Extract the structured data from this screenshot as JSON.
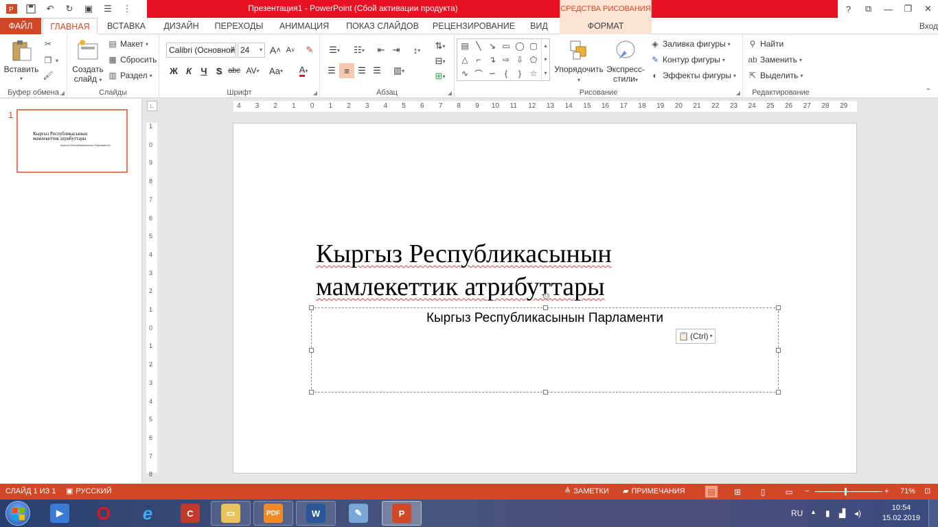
{
  "app": {
    "title": "Презентация1  -  PowerPoint (Сбой активации продукта)",
    "contextual_tab_group": "СРЕДСТВА РИСОВАНИЯ",
    "signin": "Вход",
    "accent": "#d24726"
  },
  "window_controls": {
    "help": "?",
    "restore_ribbon": "⧉",
    "minimize": "—",
    "maximize": "❐",
    "close": "✕"
  },
  "tabs": [
    "ФАЙЛ",
    "ГЛАВНАЯ",
    "ВСТАВКА",
    "ДИЗАЙН",
    "ПЕРЕХОДЫ",
    "АНИМАЦИЯ",
    "ПОКАЗ СЛАЙДОВ",
    "РЕЦЕНЗИРОВАНИЕ",
    "ВИД",
    "ФОРМАТ"
  ],
  "active_tab": "ГЛАВНАЯ",
  "ribbon": {
    "clipboard": {
      "label": "Буфер обмена",
      "paste": "Вставить"
    },
    "slides": {
      "label": "Слайды",
      "new_slide_1": "Создать",
      "new_slide_2": "слайд",
      "layout": "Макет",
      "reset": "Сбросить",
      "section": "Раздел"
    },
    "font": {
      "label": "Шрифт",
      "font_name": "Calibri (Основной",
      "font_size": "24",
      "bold": "Ж",
      "italic": "К",
      "underline": "Ч",
      "shadow": "S",
      "strike": "abc",
      "spacing": "AV",
      "case": "Aa",
      "color": "A",
      "grow": "A",
      "shrink": "A"
    },
    "paragraph": {
      "label": "Абзац"
    },
    "drawing": {
      "label": "Рисование",
      "arrange": "Упорядочить",
      "quick_styles_1": "Экспресс-",
      "quick_styles_2": "стили",
      "fill": "Заливка фигуры",
      "outline": "Контур фигуры",
      "effects": "Эффекты фигуры"
    },
    "editing": {
      "label": "Редактирование",
      "find": "Найти",
      "replace": "Заменить",
      "select": "Выделить"
    }
  },
  "thumbnails": [
    {
      "number": "1",
      "title": "Кыргыз Республикасынын мамлекеттик атрибуттары",
      "subtitle": "Кыргыз Республикасынын Парламенти"
    }
  ],
  "rulers": {
    "horizontal": [
      "4",
      "3",
      "2",
      "1",
      "0",
      "1",
      "2",
      "3",
      "4",
      "5",
      "6",
      "7",
      "8",
      "9",
      "10",
      "11",
      "12",
      "13",
      "14",
      "15",
      "16",
      "17",
      "18",
      "19",
      "20",
      "21",
      "22",
      "23",
      "24",
      "25",
      "26",
      "27",
      "28",
      "29"
    ],
    "vertical": [
      "11",
      "10",
      "9",
      "8",
      "7",
      "6",
      "5",
      "4",
      "3",
      "2",
      "1",
      "0",
      "1",
      "2",
      "3",
      "4",
      "5",
      "6",
      "7",
      "8"
    ]
  },
  "slide": {
    "title_line1": "Кыргыз Республикасынын",
    "title_line2": "мамлекеттик атрибуттары",
    "subtitle": "Кыргыз Республикасынын Парламенти",
    "paste_options": "(Ctrl)"
  },
  "status": {
    "slide_of": "СЛАЙД 1 ИЗ 1",
    "language": "РУССКИЙ",
    "notes": "ЗАМЕТКИ",
    "comments": "ПРИМЕЧАНИЯ",
    "zoom": "71%",
    "zoom_fraction": 0.45
  },
  "taskbar": {
    "language": "RU",
    "time": "10:54",
    "date": "15.02.2019",
    "apps": [
      "media-player",
      "opera",
      "internet-explorer",
      "ccleaner",
      "file-explorer",
      "foxit-pdf",
      "word",
      "paint",
      "powerpoint"
    ]
  }
}
